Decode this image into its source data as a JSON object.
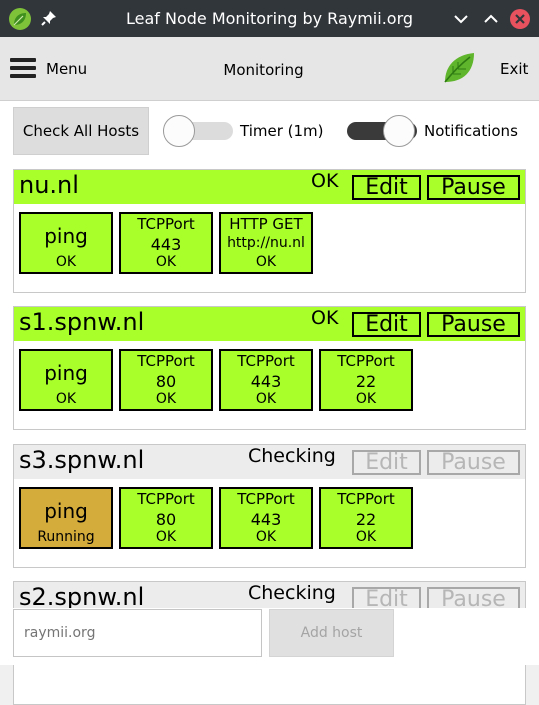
{
  "window": {
    "title": "Leaf Node Monitoring by Raymii.org",
    "title_bar_color": "#31363b",
    "icons": [
      "leaf-icon",
      "pin-icon",
      "chevron-down-icon",
      "chevron-up-icon",
      "close-icon"
    ]
  },
  "header": {
    "menu_label": "Menu",
    "title": "Monitoring",
    "exit_label": "Exit"
  },
  "toolbar": {
    "check_all_label": "Check All Hosts",
    "timer_label": "Timer (1m)",
    "timer_on": false,
    "notifications_label": "Notifications",
    "notifications_on": true
  },
  "colors": {
    "ok": "#a8ff2a",
    "running": "#d4ac3b",
    "checking_bar": "#ececec",
    "close_button": "#e8525f"
  },
  "hosts": [
    {
      "name": "nu.nl",
      "status": "OK",
      "edit_label": "Edit",
      "pause_label": "Pause",
      "checks": [
        {
          "line1": "ping",
          "line2": "",
          "state": "OK"
        },
        {
          "line1": "TCPPort",
          "line2": "443",
          "state": "OK"
        },
        {
          "line1": "HTTP GET",
          "line2": "http://nu.nl",
          "state": "OK"
        }
      ]
    },
    {
      "name": "s1.spnw.nl",
      "status": "OK",
      "edit_label": "Edit",
      "pause_label": "Pause",
      "checks": [
        {
          "line1": "ping",
          "line2": "",
          "state": "OK"
        },
        {
          "line1": "TCPPort",
          "line2": "80",
          "state": "OK"
        },
        {
          "line1": "TCPPort",
          "line2": "443",
          "state": "OK"
        },
        {
          "line1": "TCPPort",
          "line2": "22",
          "state": "OK"
        }
      ]
    },
    {
      "name": "s3.spnw.nl",
      "status": "Checking",
      "edit_label": "Edit",
      "pause_label": "Pause",
      "checks": [
        {
          "line1": "ping",
          "line2": "",
          "state": "Running"
        },
        {
          "line1": "TCPPort",
          "line2": "80",
          "state": "OK"
        },
        {
          "line1": "TCPPort",
          "line2": "443",
          "state": "OK"
        },
        {
          "line1": "TCPPort",
          "line2": "22",
          "state": "OK"
        }
      ]
    },
    {
      "name": "s2.spnw.nl",
      "status": "Checking",
      "edit_label": "Edit",
      "pause_label": "Pause"
    }
  ],
  "add_host": {
    "input_placeholder": "raymii.org",
    "button_label": "Add host"
  }
}
